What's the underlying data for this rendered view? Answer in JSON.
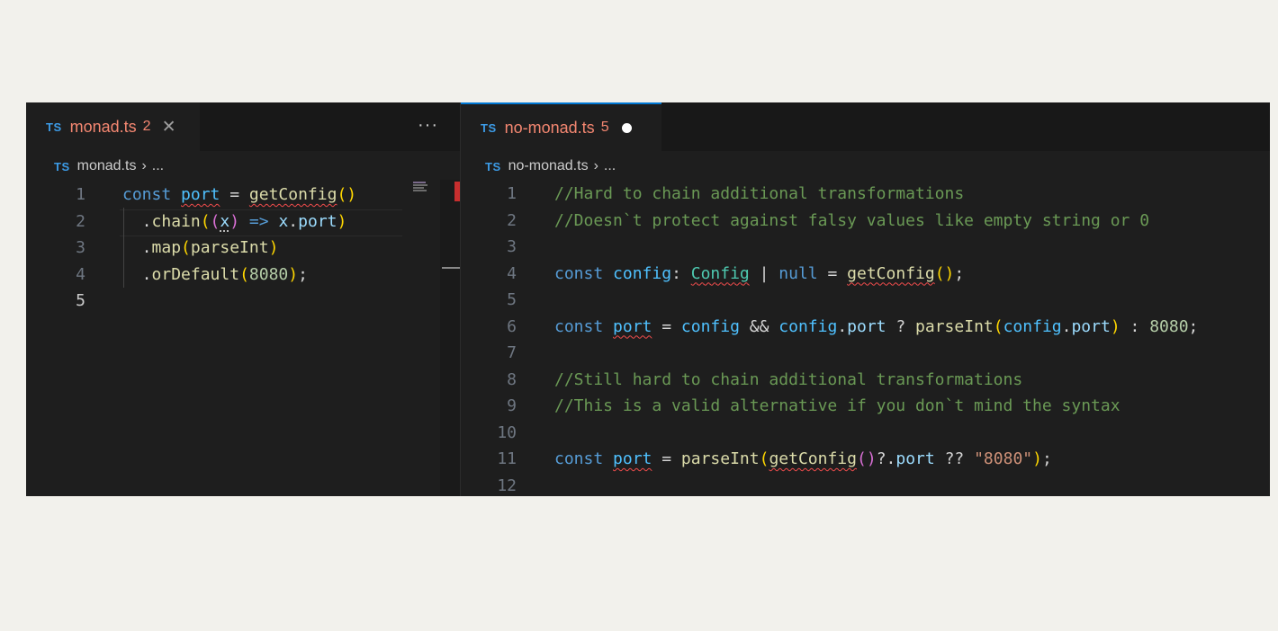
{
  "colors": {
    "accent": "#0078d4",
    "error": "#f14c4c",
    "tab_error_text": "#f48771",
    "editor_bg": "#1e1e1e"
  },
  "left_editor": {
    "tab": {
      "badge": "TS",
      "name": "monad.ts",
      "problems": "2",
      "close": "✕"
    },
    "more_actions": "···",
    "breadcrumb": {
      "badge": "TS",
      "file": "monad.ts",
      "separator": "›",
      "tail": "..."
    },
    "line_numbers": [
      "1",
      "2",
      "3",
      "4",
      "5"
    ],
    "lines": [
      [
        {
          "t": "const",
          "c": "kw"
        },
        {
          "t": " ",
          "c": "op"
        },
        {
          "t": "port",
          "c": "cn err"
        },
        {
          "t": " = ",
          "c": "op"
        },
        {
          "t": "getConfig",
          "c": "fn err"
        },
        {
          "t": "()",
          "c": "p1"
        }
      ],
      [
        {
          "t": "  .",
          "c": "op"
        },
        {
          "t": "chain",
          "c": "fn"
        },
        {
          "t": "(",
          "c": "p1"
        },
        {
          "t": "(",
          "c": "p2"
        },
        {
          "t": "x",
          "c": "vr hint"
        },
        {
          "t": ")",
          "c": "p2"
        },
        {
          "t": " ",
          "c": "op"
        },
        {
          "t": "=>",
          "c": "kw"
        },
        {
          "t": " ",
          "c": "op"
        },
        {
          "t": "x",
          "c": "vr"
        },
        {
          "t": ".",
          "c": "op"
        },
        {
          "t": "port",
          "c": "vr"
        },
        {
          "t": ")",
          "c": "p1"
        }
      ],
      [
        {
          "t": "  .",
          "c": "op"
        },
        {
          "t": "map",
          "c": "fn"
        },
        {
          "t": "(",
          "c": "p1"
        },
        {
          "t": "parseInt",
          "c": "fn"
        },
        {
          "t": ")",
          "c": "p1"
        }
      ],
      [
        {
          "t": "  .",
          "c": "op"
        },
        {
          "t": "orDefault",
          "c": "fn"
        },
        {
          "t": "(",
          "c": "p1"
        },
        {
          "t": "8080",
          "c": "nm"
        },
        {
          "t": ")",
          "c": "p1"
        },
        {
          "t": ";",
          "c": "op"
        }
      ],
      []
    ]
  },
  "right_editor": {
    "tab": {
      "badge": "TS",
      "name": "no-monad.ts",
      "problems": "5"
    },
    "breadcrumb": {
      "badge": "TS",
      "file": "no-monad.ts",
      "separator": "›",
      "tail": "..."
    },
    "line_numbers": [
      "1",
      "2",
      "3",
      "4",
      "5",
      "6",
      "7",
      "8",
      "9",
      "10",
      "11",
      "12"
    ],
    "lines": [
      [
        {
          "t": "//Hard to chain additional transformations",
          "c": "cm"
        }
      ],
      [
        {
          "t": "//Doesn`t protect against falsy values like empty string or 0",
          "c": "cm"
        }
      ],
      [],
      [
        {
          "t": "const",
          "c": "kw"
        },
        {
          "t": " ",
          "c": "op"
        },
        {
          "t": "config",
          "c": "cn"
        },
        {
          "t": ": ",
          "c": "op"
        },
        {
          "t": "Config",
          "c": "ty err"
        },
        {
          "t": " | ",
          "c": "op"
        },
        {
          "t": "null",
          "c": "kw"
        },
        {
          "t": " = ",
          "c": "op"
        },
        {
          "t": "getConfig",
          "c": "fn err"
        },
        {
          "t": "()",
          "c": "p1"
        },
        {
          "t": ";",
          "c": "op"
        }
      ],
      [],
      [
        {
          "t": "const",
          "c": "kw"
        },
        {
          "t": " ",
          "c": "op"
        },
        {
          "t": "port",
          "c": "cn err"
        },
        {
          "t": " = ",
          "c": "op"
        },
        {
          "t": "config",
          "c": "cn"
        },
        {
          "t": " && ",
          "c": "op"
        },
        {
          "t": "config",
          "c": "cn"
        },
        {
          "t": ".",
          "c": "op"
        },
        {
          "t": "port",
          "c": "vr"
        },
        {
          "t": " ? ",
          "c": "op"
        },
        {
          "t": "parseInt",
          "c": "fn"
        },
        {
          "t": "(",
          "c": "p1"
        },
        {
          "t": "config",
          "c": "cn"
        },
        {
          "t": ".",
          "c": "op"
        },
        {
          "t": "port",
          "c": "vr"
        },
        {
          "t": ")",
          "c": "p1"
        },
        {
          "t": " : ",
          "c": "op"
        },
        {
          "t": "8080",
          "c": "nm"
        },
        {
          "t": ";",
          "c": "op"
        }
      ],
      [],
      [
        {
          "t": "//Still hard to chain additional transformations",
          "c": "cm"
        }
      ],
      [
        {
          "t": "//This is a valid alternative if you don`t mind the syntax",
          "c": "cm"
        }
      ],
      [],
      [
        {
          "t": "const",
          "c": "kw"
        },
        {
          "t": " ",
          "c": "op"
        },
        {
          "t": "port",
          "c": "cn err"
        },
        {
          "t": " = ",
          "c": "op"
        },
        {
          "t": "parseInt",
          "c": "fn"
        },
        {
          "t": "(",
          "c": "p1"
        },
        {
          "t": "getConfig",
          "c": "fn err"
        },
        {
          "t": "()",
          "c": "p2"
        },
        {
          "t": "?.",
          "c": "op"
        },
        {
          "t": "port",
          "c": "vr"
        },
        {
          "t": " ?? ",
          "c": "op"
        },
        {
          "t": "\"8080\"",
          "c": "st"
        },
        {
          "t": ")",
          "c": "p1"
        },
        {
          "t": ";",
          "c": "op"
        }
      ],
      []
    ]
  }
}
